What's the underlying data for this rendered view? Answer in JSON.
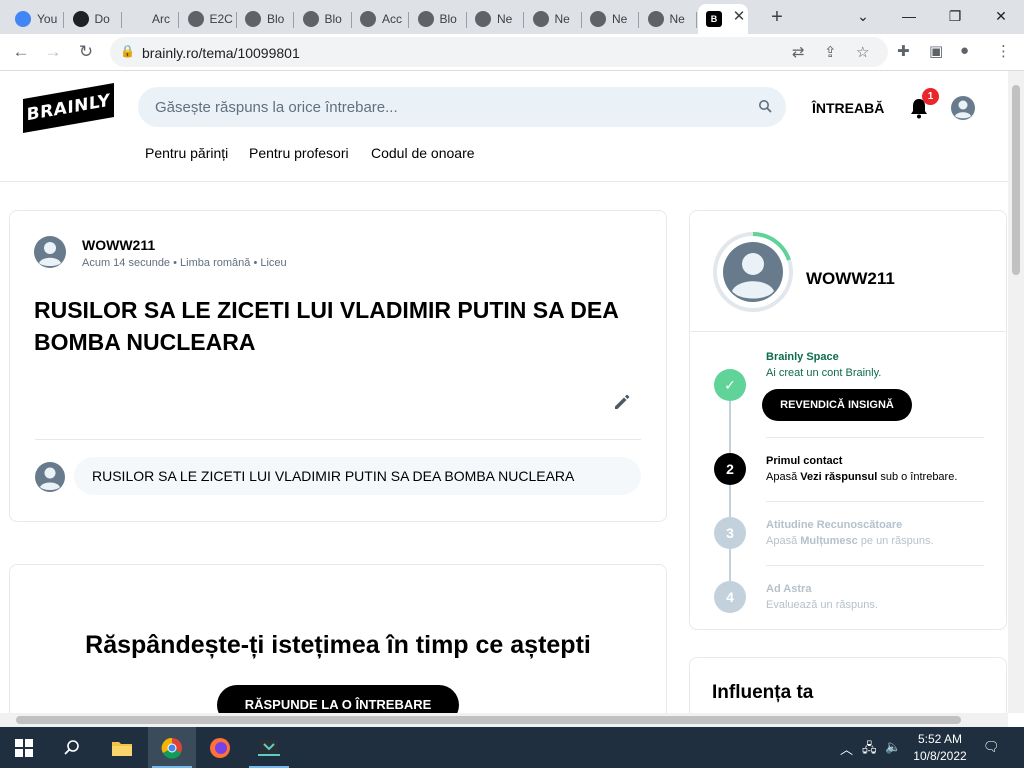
{
  "browser": {
    "tabs": [
      {
        "label": "You",
        "icon": "google-icon",
        "color": "#4285f4"
      },
      {
        "label": "Do",
        "icon": "docs-icon",
        "color": "#202124"
      },
      {
        "label": "Arc",
        "icon": "blank-icon",
        "color": "#dee1e6"
      },
      {
        "label": "E2C",
        "icon": "globe-icon",
        "color": "#5f6368"
      },
      {
        "label": "Blo",
        "icon": "globe-icon",
        "color": "#5f6368"
      },
      {
        "label": "Blo",
        "icon": "globe-icon",
        "color": "#5f6368"
      },
      {
        "label": "Acc",
        "icon": "globe-icon",
        "color": "#5f6368"
      },
      {
        "label": "Blo",
        "icon": "globe-icon",
        "color": "#5f6368"
      },
      {
        "label": "Ne",
        "icon": "chrome-icon",
        "color": "#5f6368"
      },
      {
        "label": "Ne",
        "icon": "chrome-icon",
        "color": "#5f6368"
      },
      {
        "label": "Ne",
        "icon": "chrome-icon",
        "color": "#5f6368"
      },
      {
        "label": "Ne",
        "icon": "chrome-icon",
        "color": "#5f6368"
      }
    ],
    "active_tab_icon": "brainly-icon",
    "url": "brainly.ro/tema/10099801"
  },
  "header": {
    "logo": "BRAINLY",
    "search_placeholder": "Găsește răspuns la orice întrebare...",
    "ask": "ÎNTREABĂ",
    "notifications": "1",
    "nav": [
      "Pentru părinți",
      "Pentru profesori",
      "Codul de onoare"
    ]
  },
  "question": {
    "author": "WOWW211",
    "time": "Acum 14 secunde",
    "subject": "Limba română",
    "level": "Liceu",
    "title": "RUSILOR SA LE ZICETI LUI VLADIMIR PUTIN SA DEA BOMBA NUCLEARA",
    "comment": "RUSILOR SA LE ZICETI LUI VLADIMIR PUTIN SA DEA BOMBA NUCLEARA"
  },
  "promo": {
    "heading": "Răspândește-ți istețimea în timp ce aștepti",
    "button": "RĂSPUNDE LA O ÎNTREBARE"
  },
  "profile": {
    "name": "WOWW211",
    "steps": [
      {
        "num": "✓",
        "title": "Brainly Space",
        "desc_pre": "Ai creat un cont Brainly.",
        "desc_bold": "",
        "desc_post": "",
        "state": "done"
      },
      {
        "num": "2",
        "title": "Primul contact",
        "desc_pre": "Apasă ",
        "desc_bold": "Vezi răspunsul",
        "desc_post": " sub o întrebare.",
        "state": "current"
      },
      {
        "num": "3",
        "title": "Atitudine Recunoscătoare",
        "desc_pre": "Apasă ",
        "desc_bold": "Mulțumesc",
        "desc_post": " pe un răspuns.",
        "state": "locked"
      },
      {
        "num": "4",
        "title": "Ad Astra",
        "desc_pre": "Evaluează un răspuns.",
        "desc_bold": "",
        "desc_post": "",
        "state": "locked"
      }
    ],
    "claim_button": "REVENDICĂ INSIGNĂ",
    "influence_heading": "Influența ta"
  },
  "taskbar": {
    "time": "5:52 AM",
    "date": "10/8/2022"
  }
}
